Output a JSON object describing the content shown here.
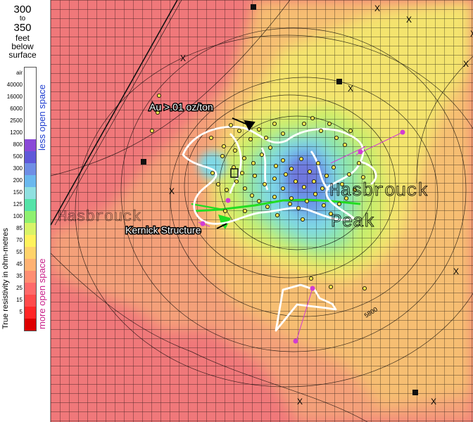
{
  "depth_header": {
    "top": "300",
    "to": "to",
    "bottom": "350",
    "unit": "feet",
    "below": "below",
    "surface": "surface"
  },
  "legend": {
    "axis_label": "True resistivity in ohm-metres",
    "less_label": "less open space",
    "more_label": "more open space",
    "less_color": "#1f3fcf",
    "more_color": "#c8208a",
    "ticks": [
      {
        "label": "air",
        "color": "#ffffff"
      },
      {
        "label": "40000",
        "color": "#ffffff"
      },
      {
        "label": "16000",
        "color": "#ffffff"
      },
      {
        "label": "6000",
        "color": "#ffffff"
      },
      {
        "label": "2500",
        "color": "#ffffff"
      },
      {
        "label": "1200",
        "color": "#ffffff"
      },
      {
        "label": "800",
        "color": "#8a49d8"
      },
      {
        "label": "500",
        "color": "#5f58d9"
      },
      {
        "label": "300",
        "color": "#6f8ee5"
      },
      {
        "label": "200",
        "color": "#6ab8ee"
      },
      {
        "label": "150",
        "color": "#8fe0e0"
      },
      {
        "label": "125",
        "color": "#55e3a8"
      },
      {
        "label": "100",
        "color": "#8ef070"
      },
      {
        "label": "85",
        "color": "#d8f368"
      },
      {
        "label": "70",
        "color": "#fff25c"
      },
      {
        "label": "55",
        "color": "#ffd36a"
      },
      {
        "label": "45",
        "color": "#ffb272"
      },
      {
        "label": "35",
        "color": "#ff8e72"
      },
      {
        "label": "25",
        "color": "#ff6a6a"
      },
      {
        "label": "15",
        "color": "#ff4b4b"
      },
      {
        "label": "5",
        "color": "#ff2727"
      },
      {
        "label": "",
        "color": "#dd0000"
      }
    ]
  },
  "map": {
    "annotations": {
      "au_label": "Au >.01 oz/ton",
      "kernick_label": "Kernick Structure",
      "peak_line1": "Hasbrouck",
      "peak_line2": "Peak",
      "contour_label": "5800",
      "left_faint_label": "Hasbrouck"
    },
    "colors": {
      "far_red": "#f0787a",
      "salmon": "#f4a079",
      "orange": "#f6be72",
      "yellow": "#f4e46e",
      "lime": "#c9ee6a",
      "green": "#8fe6a6",
      "cyan": "#7fd8e6",
      "blue": "#6a97e8",
      "indigo": "#6f78dc",
      "gold_outline": "#ffffff",
      "kernick_line": "#22dd22",
      "drill_dot": "#f2e34d"
    }
  }
}
